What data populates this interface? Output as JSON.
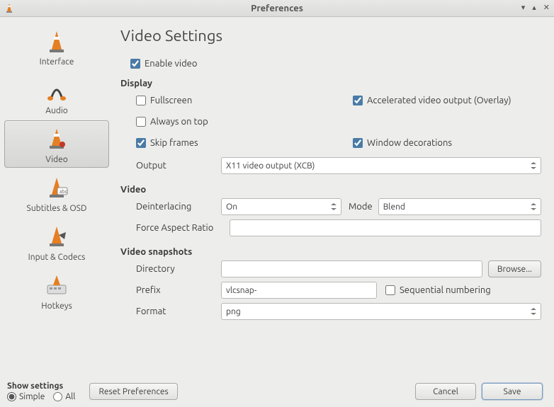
{
  "window": {
    "title": "Preferences"
  },
  "sidebar": {
    "items": [
      {
        "label": "Interface"
      },
      {
        "label": "Audio"
      },
      {
        "label": "Video"
      },
      {
        "label": "Subtitles & OSD"
      },
      {
        "label": "Input & Codecs"
      },
      {
        "label": "Hotkeys"
      }
    ],
    "selected_index": 2
  },
  "page": {
    "title": "Video Settings"
  },
  "enable_video": {
    "label": "Enable video",
    "checked": true
  },
  "display": {
    "heading": "Display",
    "fullscreen": {
      "label": "Fullscreen",
      "checked": false
    },
    "accel": {
      "label": "Accelerated video output (Overlay)",
      "checked": true
    },
    "always_on_top": {
      "label": "Always on top",
      "checked": false
    },
    "skip_frames": {
      "label": "Skip frames",
      "checked": true
    },
    "window_decor": {
      "label": "Window decorations",
      "checked": true
    },
    "output_label": "Output",
    "output_value": "X11 video output (XCB)"
  },
  "video": {
    "heading": "Video",
    "deint_label": "Deinterlacing",
    "deint_value": "On",
    "mode_label": "Mode",
    "mode_value": "Blend",
    "force_ar_label": "Force Aspect Ratio",
    "force_ar_value": ""
  },
  "snapshots": {
    "heading": "Video snapshots",
    "directory_label": "Directory",
    "directory_value": "",
    "browse_label": "Browse...",
    "prefix_label": "Prefix",
    "prefix_value": "vlcsnap-",
    "seq_label": "Sequential numbering",
    "seq_checked": false,
    "format_label": "Format",
    "format_value": "png"
  },
  "footer": {
    "show_settings_label": "Show settings",
    "simple_label": "Simple",
    "all_label": "All",
    "mode": "simple",
    "reset_label": "Reset Preferences",
    "cancel_label": "Cancel",
    "save_label": "Save"
  }
}
